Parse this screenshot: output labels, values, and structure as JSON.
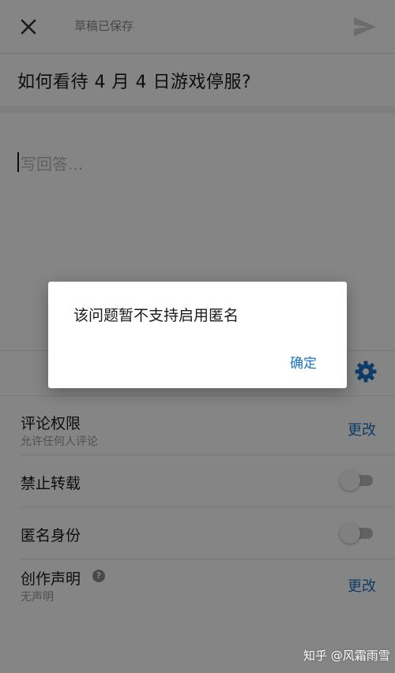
{
  "header": {
    "draft_status": "草稿已保存"
  },
  "question": {
    "title": "如何看待 4 月 4 日游戏停服?"
  },
  "editor": {
    "placeholder": "写回答..."
  },
  "settings": {
    "comment_permission": {
      "label": "评论权限",
      "value": "允许任何人评论",
      "action": "更改"
    },
    "no_repost": {
      "label": "禁止转载",
      "enabled": false
    },
    "anonymous": {
      "label": "匿名身份",
      "enabled": false
    },
    "creation_statement": {
      "label": "创作声明",
      "value": "无声明",
      "action": "更改",
      "help_glyph": "?"
    }
  },
  "dialog": {
    "message": "该问题暂不支持启用匿名",
    "confirm_label": "确定"
  },
  "watermark": "知乎 @风霜雨雪",
  "colors": {
    "accent": "#1a73c7",
    "overlay": "#000000",
    "toggle_track": "#bdbdbd"
  }
}
